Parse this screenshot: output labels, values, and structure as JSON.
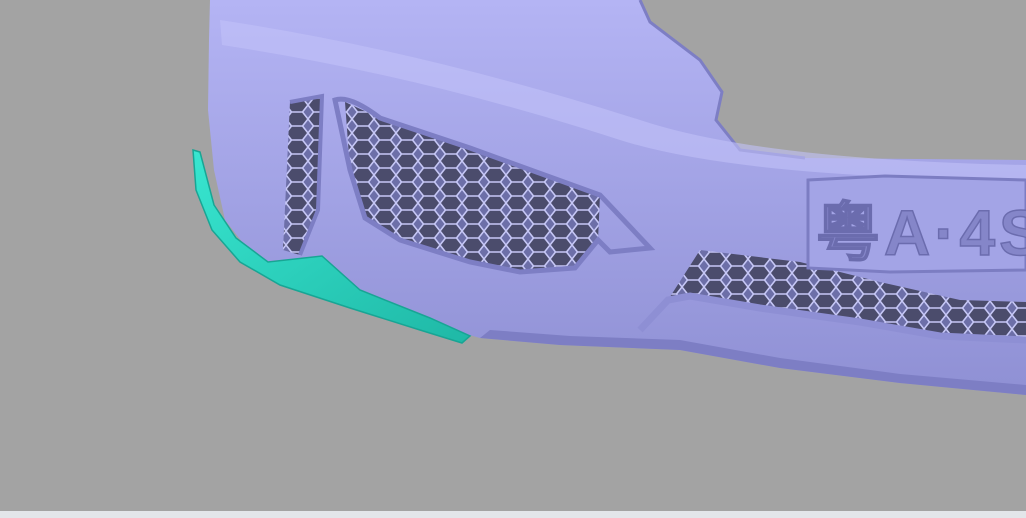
{
  "viewport": {
    "background": "#a3a3a3",
    "model_color": "#a9a9ef",
    "model_shadow": "#7d7ec4",
    "highlight_color": "#2fd9c4",
    "plate_text": "粤A·4S"
  },
  "status_strip": {
    "color": "#e3e6ea"
  }
}
